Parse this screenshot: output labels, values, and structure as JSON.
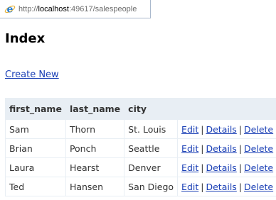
{
  "browser": {
    "url_prefix": "http://",
    "url_host": "localhost",
    "url_path": ":49617/salespeople"
  },
  "page": {
    "title": "Index",
    "create_link": "Create New"
  },
  "table": {
    "headers": [
      "first_name",
      "last_name",
      "city",
      ""
    ],
    "rows": [
      {
        "first_name": "Sam",
        "last_name": "Thorn",
        "city": "St. Louis"
      },
      {
        "first_name": "Brian",
        "last_name": "Ponch",
        "city": "Seattle"
      },
      {
        "first_name": "Laura",
        "last_name": "Hearst",
        "city": "Denver"
      },
      {
        "first_name": "Ted",
        "last_name": "Hansen",
        "city": "San Diego"
      }
    ],
    "actions": {
      "edit": "Edit",
      "details": "Details",
      "delete": "Delete",
      "separator": "|"
    }
  },
  "colors": {
    "link": "#1a3fb5",
    "header_bg": "#e8eef4",
    "ie_icon": "#2a7fd4"
  },
  "icons": {
    "browser": "internet-explorer-icon"
  }
}
